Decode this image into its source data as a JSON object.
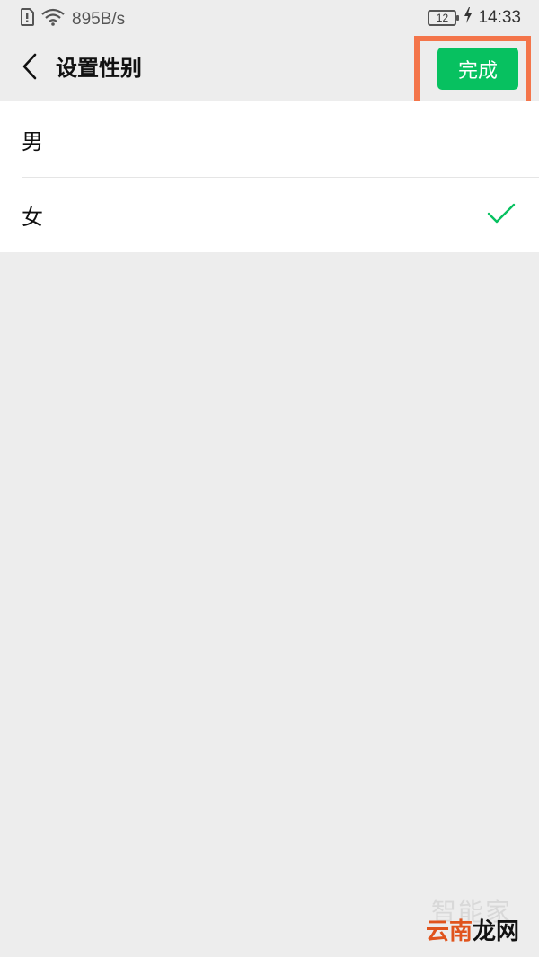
{
  "status_bar": {
    "network_speed": "895B/s",
    "battery_level": "12",
    "time": "14:33",
    "icons": [
      "sim-alert-icon",
      "wifi-icon",
      "battery-icon",
      "charging-bolt-icon"
    ]
  },
  "header": {
    "title": "设置性别",
    "done_label": "完成",
    "back_icon": "chevron-left-icon"
  },
  "options": [
    {
      "label": "男",
      "selected": false
    },
    {
      "label": "女",
      "selected": true
    }
  ],
  "watermark": {
    "top_text": "智能家",
    "brand_part1": "云南",
    "brand_part2": "龙网"
  },
  "colors": {
    "accent": "#07c160",
    "highlight": "#f4754a",
    "background": "#ededed"
  }
}
